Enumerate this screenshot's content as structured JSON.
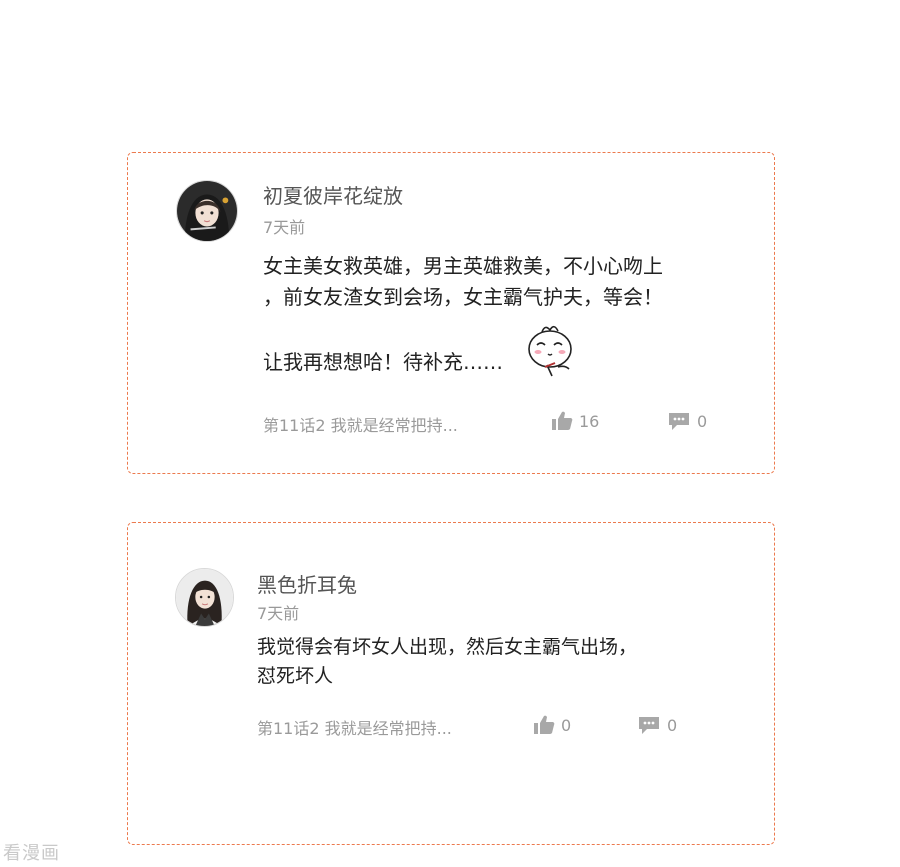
{
  "comments": [
    {
      "username": "初夏彼岸花绽放",
      "time": "7天前",
      "content_lines": [
        "女主美女救英雄，男主英雄救美，不小心吻上",
        "，前女友渣女到会场，女主霸气护夫，等会！",
        "",
        "让我再想想哈！待补充……"
      ],
      "sticker_icon": "thinking-bun-sticker",
      "chapter": "第11话2 我就是经常把持...",
      "likes": "16",
      "replies": "0"
    },
    {
      "username": "黑色折耳兔",
      "time": "7天前",
      "content_lines": [
        "我觉得会有坏女人出现，然后女主霸气出场，",
        "怼死坏人"
      ],
      "chapter": "第11话2 我就是经常把持...",
      "likes": "0",
      "replies": "0"
    }
  ],
  "watermark": "看漫画",
  "colors": {
    "card_border": "#ec7a4e",
    "muted_text": "#9a9a9a",
    "body_text": "#222222"
  },
  "icons": {
    "like": "thumbs-up-icon",
    "reply": "comment-bubble-icon"
  }
}
